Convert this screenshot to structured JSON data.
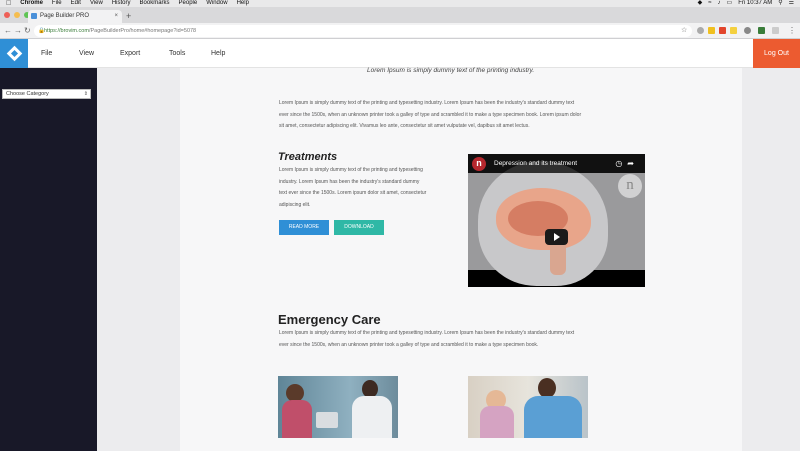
{
  "mac_menu": {
    "items": [
      "Chrome",
      "File",
      "Edit",
      "View",
      "History",
      "Bookmarks",
      "People",
      "Window",
      "Help"
    ],
    "clock": "Fri 10:37 AM"
  },
  "browser": {
    "tab_title": "Page Builder PRO",
    "url_host": "https://brovim.com",
    "url_path": "/PageBuilderPro/home#homepage?id=5078"
  },
  "app_menu": {
    "items": [
      "File",
      "View",
      "Export",
      "Tools",
      "Help"
    ],
    "logout_label": "Log Out"
  },
  "sidebar": {
    "category_select_value": "Choose Category"
  },
  "content": {
    "tagline": "Lorem Ipsum is simply dummy text of the printing industry.",
    "intro_lines": [
      "Lorem Ipsum is simply dummy text of the printing and typesetting industry. Lorem Ipsum has been the industry's standard dummy text",
      "ever since the 1500s, when an unknown printer took a galley of type and scrambled it to make a type specimen book. Lorem ipsum dolor",
      "sit amet, consectetur adipiscing elit. Vivamus leo ante, consectetur sit amet vulputate vel, dapibus sit amet lectus."
    ],
    "treatments": {
      "heading": "Treatments",
      "lines": [
        "Lorem Ipsum is simply dummy text of the printing and typesetting",
        "industry. Lorem Ipsum has been the industry's standard dummy",
        "text ever since the 1500s. Lorem ipsum dolor sit amet, consectetur",
        "adipiscing elit."
      ],
      "read_more_label": "READ MORE",
      "download_label": "DOWNLOAD"
    },
    "video": {
      "title": "Depression and its treatment",
      "channel_letter": "n",
      "badge_letter": "n"
    },
    "emergency": {
      "heading": "Emergency Care",
      "lines": [
        "Lorem Ipsum is simply dummy text of the printing and typesetting industry. Lorem Ipsum has been the industry's standard dummy text",
        "ever since the 1500s, when an unknown printer took a galley of type and scrambled it to make a type specimen book."
      ]
    }
  },
  "colors": {
    "logo_blue": "#2f8fd6",
    "logout_orange": "#ec5b30",
    "read_more_blue": "#2f8fd6",
    "download_teal": "#2fb8a6",
    "sidebar_dark": "#181828"
  }
}
